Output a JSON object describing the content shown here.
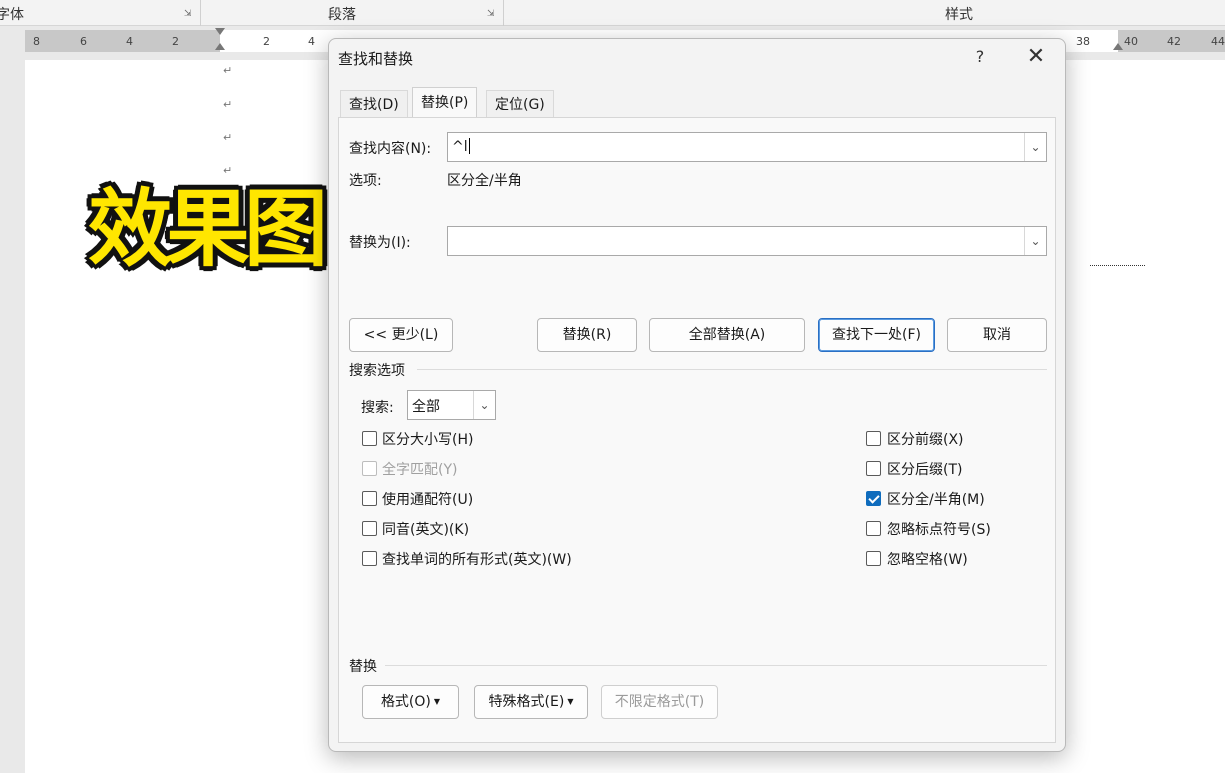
{
  "ribbon": {
    "groups": [
      {
        "label": "字体"
      },
      {
        "label": "段落"
      },
      {
        "label": "样式"
      }
    ]
  },
  "ruler": {
    "ticks_left": [
      "8",
      "6",
      "4",
      "2"
    ],
    "ticks_right": [
      "2",
      "4",
      "38",
      "40",
      "42",
      "44"
    ]
  },
  "document": {
    "overlay_text": "效果图"
  },
  "dialog": {
    "title": "查找和替换",
    "help_label": "?",
    "close_label": "✕",
    "tabs": [
      {
        "label": "查找(D)"
      },
      {
        "label": "替换(P)",
        "active": true
      },
      {
        "label": "定位(G)"
      }
    ],
    "find": {
      "label": "查找内容(N):",
      "value": "^l"
    },
    "options": {
      "label": "选项:",
      "value": "区分全/半角"
    },
    "replace": {
      "label": "替换为(I):",
      "value": ""
    },
    "buttons": {
      "less": "<< 更少(L)",
      "replace": "替换(R)",
      "replace_all": "全部替换(A)",
      "find_next": "查找下一处(F)",
      "cancel": "取消"
    },
    "search_options": {
      "header": "搜索选项",
      "search_label": "搜索:",
      "search_value": "全部",
      "left_checks": [
        {
          "label": "区分大小写(H)",
          "checked": false,
          "enabled": true
        },
        {
          "label": "全字匹配(Y)",
          "checked": false,
          "enabled": false
        },
        {
          "label": "使用通配符(U)",
          "checked": false,
          "enabled": true
        },
        {
          "label": "同音(英文)(K)",
          "checked": false,
          "enabled": true
        },
        {
          "label": "查找单词的所有形式(英文)(W)",
          "checked": false,
          "enabled": true
        }
      ],
      "right_checks": [
        {
          "label": "区分前缀(X)",
          "checked": false,
          "enabled": true
        },
        {
          "label": "区分后缀(T)",
          "checked": false,
          "enabled": true
        },
        {
          "label": "区分全/半角(M)",
          "checked": true,
          "enabled": true
        },
        {
          "label": "忽略标点符号(S)",
          "checked": false,
          "enabled": true
        },
        {
          "label": "忽略空格(W)",
          "checked": false,
          "enabled": true
        }
      ]
    },
    "replace_section": {
      "header": "替换",
      "format": "格式(O)",
      "special": "特殊格式(E)",
      "no_format": "不限定格式(T)"
    }
  },
  "colors": {
    "accent": "#0f6cbd",
    "overlay_fill": "#ffe600",
    "overlay_outline": "#111111"
  }
}
